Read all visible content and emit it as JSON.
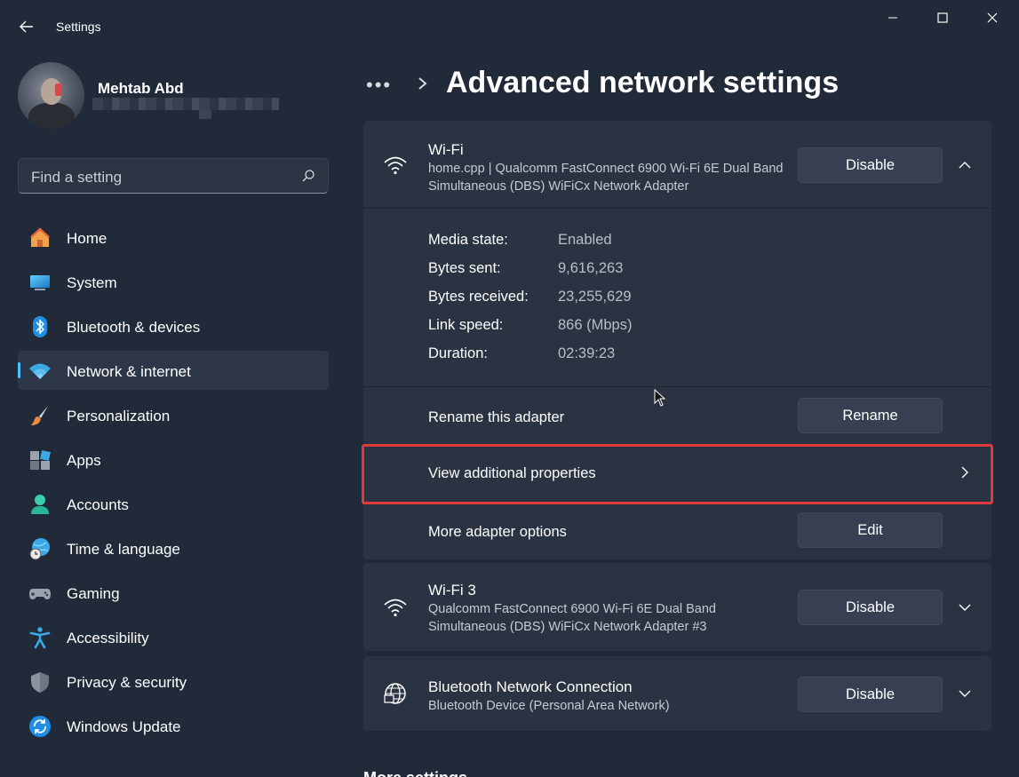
{
  "window": {
    "title": "Settings"
  },
  "profile": {
    "name": "Mehtab Abd"
  },
  "search": {
    "placeholder": "Find a setting"
  },
  "nav": {
    "items": [
      {
        "label": "Home",
        "icon": "home-icon"
      },
      {
        "label": "System",
        "icon": "system-icon"
      },
      {
        "label": "Bluetooth & devices",
        "icon": "bluetooth-icon"
      },
      {
        "label": "Network & internet",
        "icon": "wifi-icon",
        "active": true
      },
      {
        "label": "Personalization",
        "icon": "brush-icon"
      },
      {
        "label": "Apps",
        "icon": "apps-icon"
      },
      {
        "label": "Accounts",
        "icon": "accounts-icon"
      },
      {
        "label": "Time & language",
        "icon": "globe-clock-icon"
      },
      {
        "label": "Gaming",
        "icon": "gamepad-icon"
      },
      {
        "label": "Accessibility",
        "icon": "accessibility-icon"
      },
      {
        "label": "Privacy & security",
        "icon": "shield-icon"
      },
      {
        "label": "Windows Update",
        "icon": "update-icon"
      }
    ]
  },
  "header": {
    "breadcrumb_more": "•••",
    "title": "Advanced network settings"
  },
  "adapters": [
    {
      "name": "Wi-Fi",
      "description": "home.cpp | Qualcomm FastConnect 6900 Wi-Fi 6E Dual Band Simultaneous (DBS) WiFiCx Network Adapter",
      "button": "Disable",
      "expanded": true,
      "icon": "wifi-icon"
    },
    {
      "name": "Wi-Fi 3",
      "description": "Qualcomm FastConnect 6900 Wi-Fi 6E Dual Band Simultaneous (DBS) WiFiCx Network Adapter #3",
      "button": "Disable",
      "expanded": false,
      "icon": "wifi-icon"
    },
    {
      "name": "Bluetooth Network Connection",
      "description": "Bluetooth Device (Personal Area Network)",
      "button": "Disable",
      "expanded": false,
      "icon": "globe-network-icon"
    }
  ],
  "wifi_properties": [
    {
      "label": "Media state:",
      "value": "Enabled"
    },
    {
      "label": "Bytes sent:",
      "value": "9,616,263"
    },
    {
      "label": "Bytes received:",
      "value": "23,255,629"
    },
    {
      "label": "Link speed:",
      "value": "866 (Mbps)"
    },
    {
      "label": "Duration:",
      "value": "02:39:23"
    }
  ],
  "wifi_actions": {
    "rename_label": "Rename this adapter",
    "rename_button": "Rename",
    "view_props_label": "View additional properties",
    "more_options_label": "More adapter options",
    "edit_button": "Edit"
  },
  "footer": {
    "more_settings": "More settings"
  },
  "colors": {
    "background": "#202a38",
    "card": "#2a3342",
    "accent": "#4cc2ff",
    "highlight": "#e0383b"
  }
}
